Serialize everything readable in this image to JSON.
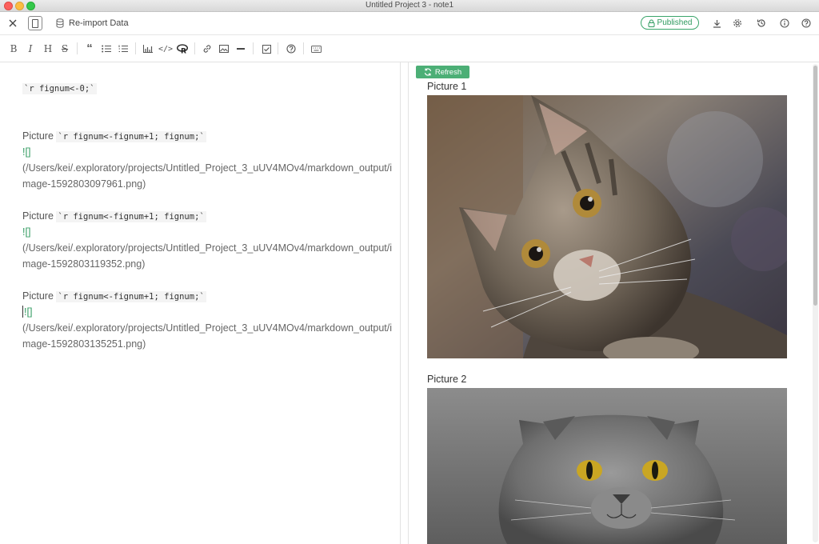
{
  "window": {
    "title": "Untitled Project 3 - note1"
  },
  "header": {
    "reimport_label": "Re-import Data",
    "published_label": "Published"
  },
  "toolbar": {
    "items": [
      "bold-icon",
      "italic-icon",
      "heading-icon",
      "strikethrough-icon",
      "quote-icon",
      "bullet-list-icon",
      "numbered-list-icon",
      "chart-icon",
      "code-icon",
      "r-icon",
      "link-icon",
      "image-icon",
      "horizontal-rule-icon",
      "checkbox-icon",
      "help-icon",
      "keyboard-icon"
    ]
  },
  "editor": {
    "line1_code": "`r fignum<-0;`",
    "blocks": [
      {
        "prefix": "Picture ",
        "code": "`r fignum<-fignum+1; fignum;`",
        "img_open": "![]",
        "path1": "(/Users/kei/.exploratory/projects/Untitled_Project_3_uUV4MOv4/markdown_output/i",
        "path2": "mage-1592803097961.png)"
      },
      {
        "prefix": "Picture ",
        "code": "`r fignum<-fignum+1; fignum;`",
        "img_open": "![]",
        "path1": "(/Users/kei/.exploratory/projects/Untitled_Project_3_uUV4MOv4/markdown_output/i",
        "path2": "mage-1592803119352.png)"
      },
      {
        "prefix": "Picture ",
        "code": "`r fignum<-fignum+1; fignum;`",
        "img_open": "![]",
        "path1": "(/Users/kei/.exploratory/projects/Untitled_Project_3_uUV4MOv4/markdown_output/i",
        "path2": "mage-1592803135251.png)"
      }
    ]
  },
  "preview": {
    "refresh_label": "Refresh",
    "captions": [
      "Picture 1",
      "Picture 2"
    ]
  },
  "colors": {
    "accent_green": "#3aa56a",
    "refresh_bg": "#4caf76"
  }
}
